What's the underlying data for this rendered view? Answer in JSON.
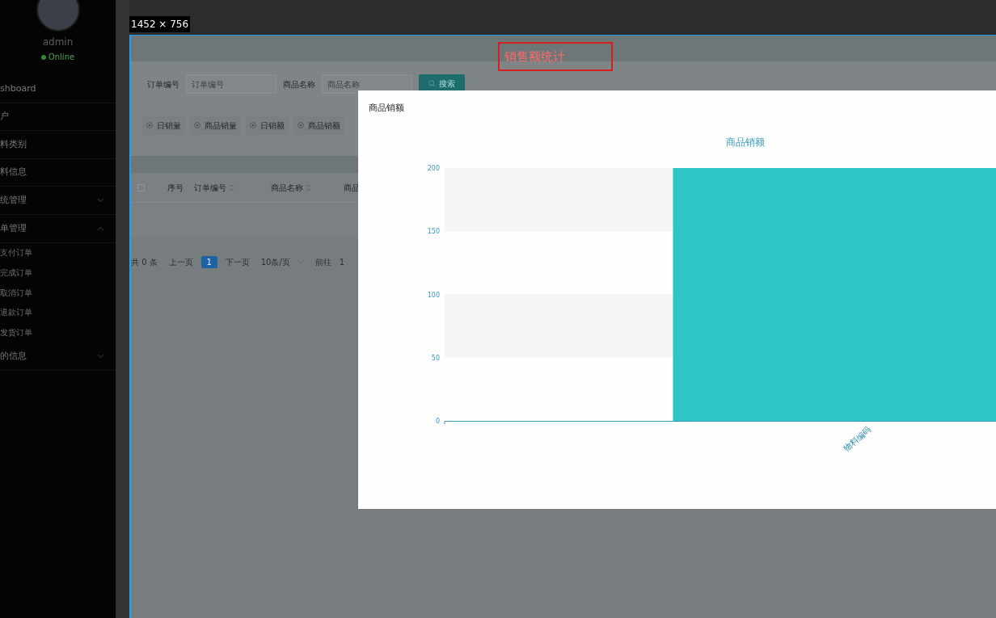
{
  "sidebar": {
    "user": "admin",
    "status": "Online",
    "items": [
      {
        "kind": "link",
        "label": "shboard"
      },
      {
        "kind": "link",
        "label": "户"
      },
      {
        "kind": "link",
        "label": "料类别"
      },
      {
        "kind": "link",
        "label": "料信息"
      },
      {
        "kind": "group",
        "label": "统管理",
        "expanded": false
      },
      {
        "kind": "group",
        "label": "单管理",
        "expanded": true,
        "children": [
          {
            "label": "支付订单"
          },
          {
            "label": "完成订单"
          },
          {
            "label": "取消订单"
          },
          {
            "label": "退款订单"
          },
          {
            "label": "发货订单"
          }
        ]
      },
      {
        "kind": "group",
        "label": "的信息",
        "expanded": false
      }
    ]
  },
  "capture": {
    "size_label": "1452 × 756",
    "annotation": "销售额统计"
  },
  "filters": [
    {
      "label": "订单编号",
      "placeholder": "订单编号"
    },
    {
      "label": "商品名称",
      "placeholder": "商品名称"
    }
  ],
  "search_button": "搜索",
  "radios": [
    {
      "label": "日销量"
    },
    {
      "label": "商品销量"
    },
    {
      "label": "日销额"
    },
    {
      "label": "商品销额"
    }
  ],
  "table": {
    "select_all": {
      "checked": false
    },
    "columns": [
      {
        "label": "序号",
        "sortable": false
      },
      {
        "label": "订单编号",
        "sortable": true
      },
      {
        "label": "商品名称",
        "sortable": true
      },
      {
        "label": "商品",
        "sortable": false
      }
    ]
  },
  "pagination": {
    "total": "共 0 条",
    "prev": "上一页",
    "pages": [
      {
        "label": "1",
        "selected": true
      }
    ],
    "next": "下一页",
    "page_size": "10条/页",
    "goto": "前往",
    "goto_value": "1"
  },
  "modal": {
    "title": "商品销额",
    "chart_data": {
      "type": "bar",
      "title": "商品销额",
      "categories": [
        "物料编码"
      ],
      "series": [
        {
          "color": "#2ec6c6",
          "values": [
            200
          ]
        }
      ],
      "ylim": [
        0,
        200
      ],
      "yticks": [
        0,
        50,
        100,
        150,
        200
      ]
    }
  }
}
